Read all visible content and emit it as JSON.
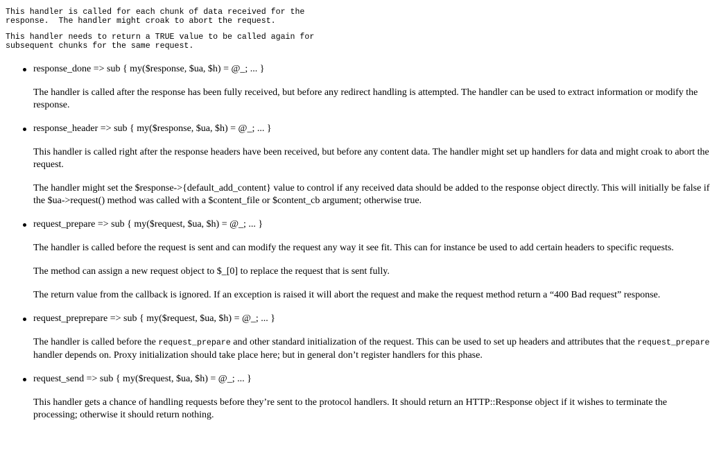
{
  "intro": {
    "pre1": "This handler is called for each chunk of data received for the\nresponse.  The handler might croak to abort the request.",
    "pre2": "This handler needs to return a TRUE value to be called again for\nsubsequent chunks for the same request."
  },
  "items": [
    {
      "head": "response_done => sub { my($response, $ua, $h) = @_; ... }",
      "paras": [
        "The handler is called after the response has been fully received, but before any redirect handling is attempted. The handler can be used to extract information or modify the response."
      ]
    },
    {
      "head": "response_header => sub { my($response, $ua, $h) = @_; ... }",
      "paras": [
        "This handler is called right after the response headers have been received, but before any content data. The handler might set up handlers for data and might croak to abort the request.",
        "The handler might set the $response->{default_add_content} value to control if any received data should be added to the response object directly. This will initially be false if the $ua->request() method was called with a $content_file or $content_cb argument; otherwise true."
      ]
    },
    {
      "head": "request_prepare => sub { my($request, $ua, $h) = @_; ... }",
      "paras": [
        "The handler is called before the request is sent and can modify the request any way it see fit. This can for instance be used to add certain headers to specific requests.",
        "The method can assign a new request object to $_[0] to replace the request that is sent fully.",
        "The return value from the callback is ignored. If an exception is raised it will abort the request and make the request method return a “400 Bad request” response."
      ]
    },
    {
      "head": "request_preprepare => sub { my($request, $ua, $h) = @_; ... }",
      "para_parts": [
        "The handler is called before the ",
        "request_prepare",
        " and other standard initialization of the request. This can be used to set up headers and attributes that the ",
        "request_prepare",
        " handler depends on. Proxy initialization should take place here; but in general don’t register handlers for this phase."
      ]
    },
    {
      "head": "request_send => sub { my($request, $ua, $h) = @_; ... }",
      "paras": [
        "This handler gets a chance of handling requests before they’re sent to the protocol handlers. It should return an HTTP::Response object if it wishes to terminate the processing; otherwise it should return nothing."
      ]
    }
  ]
}
